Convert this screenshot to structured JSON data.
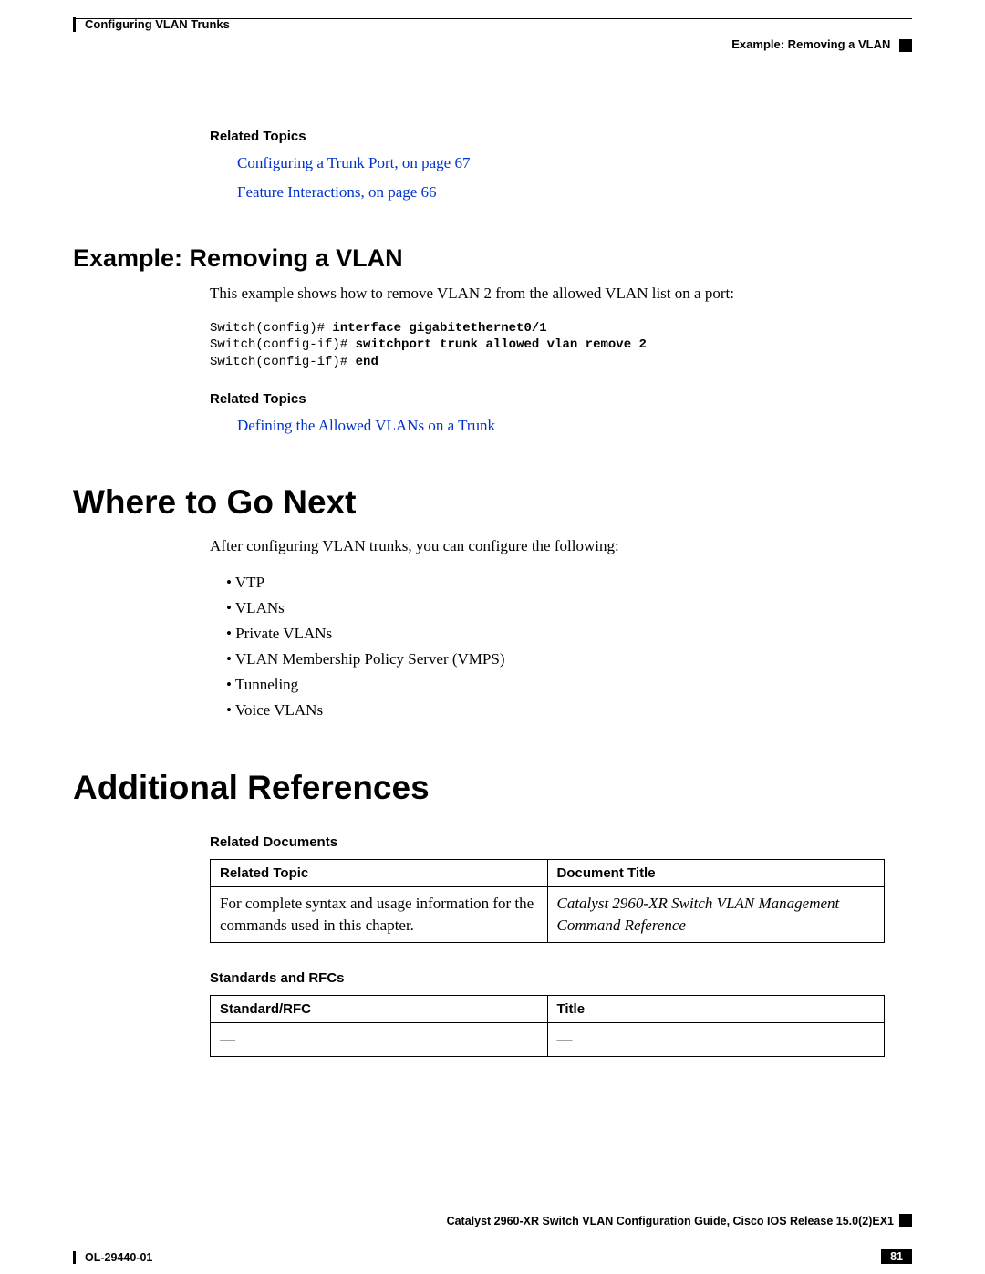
{
  "header": {
    "chapter": "Configuring VLAN Trunks",
    "section": "Example: Removing a VLAN"
  },
  "related_topics_1": {
    "heading": "Related Topics",
    "links": [
      "Configuring a Trunk Port,  on page 67",
      "Feature Interactions,  on page 66"
    ]
  },
  "example": {
    "heading": "Example: Removing a VLAN",
    "intro": "This example shows how to remove VLAN 2 from the allowed VLAN list on a port:",
    "code_lines": [
      {
        "prompt": "Switch(config)# ",
        "cmd": "interface gigabitethernet0/1"
      },
      {
        "prompt": "Switch(config-if)# ",
        "cmd": "switchport trunk allowed vlan remove 2"
      },
      {
        "prompt": "Switch(config-if)# ",
        "cmd": "end"
      }
    ],
    "related_heading": "Related Topics",
    "related_links": [
      "Defining the Allowed VLANs on a Trunk"
    ]
  },
  "where_next": {
    "heading": "Where to Go Next",
    "intro": "After configuring VLAN trunks, you can configure the following:",
    "items": [
      "VTP",
      "VLANs",
      "Private VLANs",
      "VLAN Membership Policy Server (VMPS)",
      "Tunneling",
      "Voice VLANs"
    ]
  },
  "additional_refs": {
    "heading": "Additional References",
    "related_docs_title": "Related Documents",
    "related_docs_table": {
      "headers": [
        "Related Topic",
        "Document Title"
      ],
      "rows": [
        {
          "topic": "For complete syntax and usage information for the commands used in this chapter.",
          "title": "Catalyst 2960-XR Switch VLAN Management Command Reference"
        }
      ]
    },
    "standards_title": "Standards and RFCs",
    "standards_table": {
      "headers": [
        "Standard/RFC",
        "Title"
      ],
      "rows": [
        {
          "std": "—",
          "title": "—"
        }
      ]
    }
  },
  "footer": {
    "book_title": "Catalyst 2960-XR Switch VLAN Configuration Guide, Cisco IOS Release 15.0(2)EX1",
    "doc_number": "OL-29440-01",
    "page": "81"
  }
}
